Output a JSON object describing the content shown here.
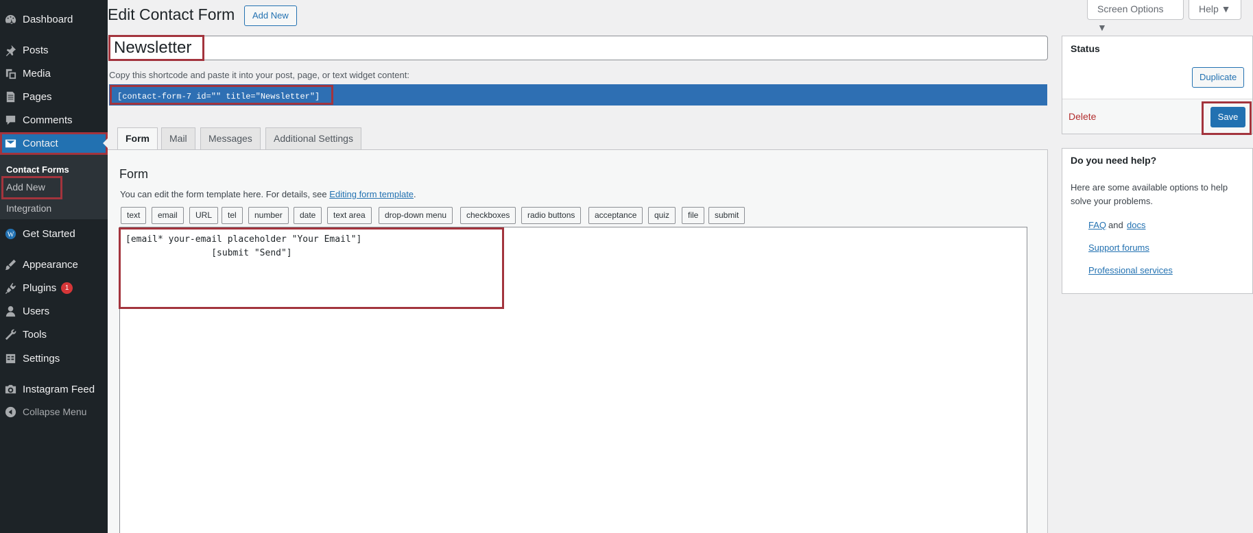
{
  "sidebar": {
    "items": [
      {
        "label": "Dashboard",
        "icon": "dashboard-icon"
      },
      {
        "label": "Posts",
        "icon": "pin-icon"
      },
      {
        "label": "Media",
        "icon": "media-icon"
      },
      {
        "label": "Pages",
        "icon": "pages-icon"
      },
      {
        "label": "Comments",
        "icon": "comments-icon"
      },
      {
        "label": "Contact",
        "icon": "envelope-icon"
      },
      {
        "label": "Get Started",
        "icon": "wordpress-icon"
      },
      {
        "label": "Appearance",
        "icon": "brush-icon"
      },
      {
        "label": "Plugins",
        "icon": "plugin-icon",
        "badge": "1"
      },
      {
        "label": "Users",
        "icon": "users-icon"
      },
      {
        "label": "Tools",
        "icon": "wrench-icon"
      },
      {
        "label": "Settings",
        "icon": "settings-icon"
      },
      {
        "label": "Instagram Feed",
        "icon": "camera-icon"
      },
      {
        "label": "Collapse Menu",
        "icon": "collapse-icon"
      }
    ],
    "submenu": [
      "Contact Forms",
      "Add New",
      "Integration"
    ]
  },
  "header": {
    "title": "Edit Contact Form",
    "add_new": "Add New",
    "screen_options": "Screen Options ▼",
    "help": "Help ▼"
  },
  "form": {
    "title_value": "Newsletter",
    "shortcode_desc": "Copy this shortcode and paste it into your post, page, or text widget content:",
    "shortcode": "[contact-form-7 id=\"\" title=\"Newsletter\"]",
    "tabs": [
      "Form",
      "Mail",
      "Messages",
      "Additional Settings"
    ],
    "panel_heading": "Form",
    "panel_desc": "You can edit the form template here. For details, see",
    "panel_desc_link": "Editing form template",
    "panel_desc_end": ".",
    "tag_buttons": [
      "text",
      "email",
      "URL",
      "tel",
      "number",
      "date",
      "text area",
      "drop-down menu",
      "checkboxes",
      "radio buttons",
      "acceptance",
      "quiz",
      "file",
      "submit"
    ],
    "template": "[email* your-email placeholder \"Your Email\"]\n                [submit \"Send\"]"
  },
  "status": {
    "title": "Status",
    "duplicate": "Duplicate",
    "delete": "Delete",
    "save": "Save"
  },
  "help_box": {
    "title": "Do you need help?",
    "desc": "Here are some available options to help solve your problems.",
    "faq": "FAQ",
    "and": "and",
    "docs": "docs",
    "support": "Support forums",
    "professional": "Professional services"
  },
  "colors": {
    "accent": "#2271b1",
    "sidebar_bg": "#1d2327",
    "highlight": "#a3343d",
    "badge": "#d63638"
  }
}
